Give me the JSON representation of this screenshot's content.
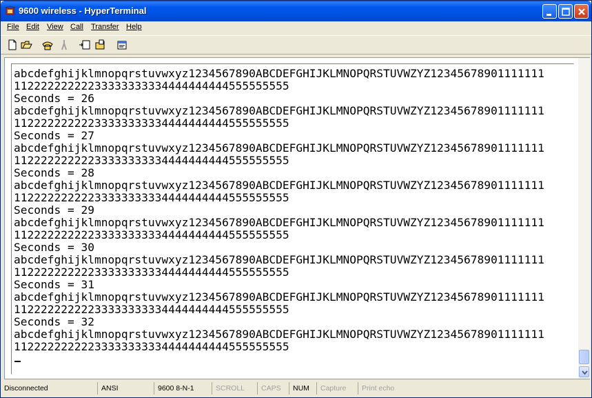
{
  "window": {
    "title": "9600 wireless - HyperTerminal"
  },
  "menu": {
    "items": [
      {
        "label": "File"
      },
      {
        "label": "Edit"
      },
      {
        "label": "View"
      },
      {
        "label": "Call"
      },
      {
        "label": "Transfer"
      },
      {
        "label": "Help"
      }
    ]
  },
  "toolbar": {
    "icons": [
      "new-connection-icon",
      "open-icon",
      "call-icon",
      "disconnect-icon",
      "send-icon",
      "receive-icon",
      "properties-icon"
    ]
  },
  "terminal": {
    "lines": [
      "abcdefghijklmnopqrstuvwxyz1234567890ABCDEFGHIJKLMNOPQRSTUVWZYZ12345678901111111",
      "11222222222233333333334444444444555555555",
      "Seconds = 26",
      "abcdefghijklmnopqrstuvwxyz1234567890ABCDEFGHIJKLMNOPQRSTUVWZYZ12345678901111111",
      "11222222222233333333334444444444555555555",
      "Seconds = 27",
      "abcdefghijklmnopqrstuvwxyz1234567890ABCDEFGHIJKLMNOPQRSTUVWZYZ12345678901111111",
      "11222222222233333333334444444444555555555",
      "Seconds = 28",
      "abcdefghijklmnopqrstuvwxyz1234567890ABCDEFGHIJKLMNOPQRSTUVWZYZ12345678901111111",
      "11222222222233333333334444444444555555555",
      "Seconds = 29",
      "abcdefghijklmnopqrstuvwxyz1234567890ABCDEFGHIJKLMNOPQRSTUVWZYZ12345678901111111",
      "11222222222233333333334444444444555555555",
      "Seconds = 30",
      "abcdefghijklmnopqrstuvwxyz1234567890ABCDEFGHIJKLMNOPQRSTUVWZYZ12345678901111111",
      "11222222222233333333334444444444555555555",
      "Seconds = 31",
      "abcdefghijklmnopqrstuvwxyz1234567890ABCDEFGHIJKLMNOPQRSTUVWZYZ12345678901111111",
      "11222222222233333333334444444444555555555",
      "Seconds = 32",
      "abcdefghijklmnopqrstuvwxyz1234567890ABCDEFGHIJKLMNOPQRSTUVWZYZ12345678901111111",
      "11222222222233333333334444444444555555555"
    ]
  },
  "status": {
    "connection": "Disconnected",
    "emulation": "ANSI",
    "port_settings": "9600 8-N-1",
    "scroll": "SCROLL",
    "caps": "CAPS",
    "num": "NUM",
    "capture": "Capture",
    "print_echo": "Print echo"
  }
}
